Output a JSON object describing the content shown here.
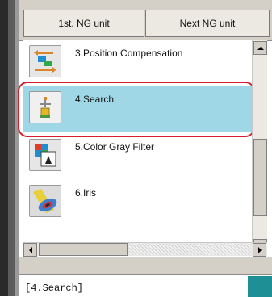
{
  "toolbar": {
    "first_ng_label": "1st. NG unit",
    "next_ng_label": "Next NG unit"
  },
  "units": [
    {
      "label": "3.Position Compensation",
      "icon": "position-compensation-icon"
    },
    {
      "label": "4.Search",
      "icon": "search-unit-icon",
      "selected": true
    },
    {
      "label": "5.Color Gray Filter",
      "icon": "color-gray-filter-icon"
    },
    {
      "label": "6.Iris",
      "icon": "iris-icon"
    }
  ],
  "status": {
    "text": "[4.Search]"
  },
  "colors": {
    "selected_bg": "#9fd7e6",
    "highlight_ring": "#d21e2e",
    "status_accent": "#1f8f96"
  }
}
